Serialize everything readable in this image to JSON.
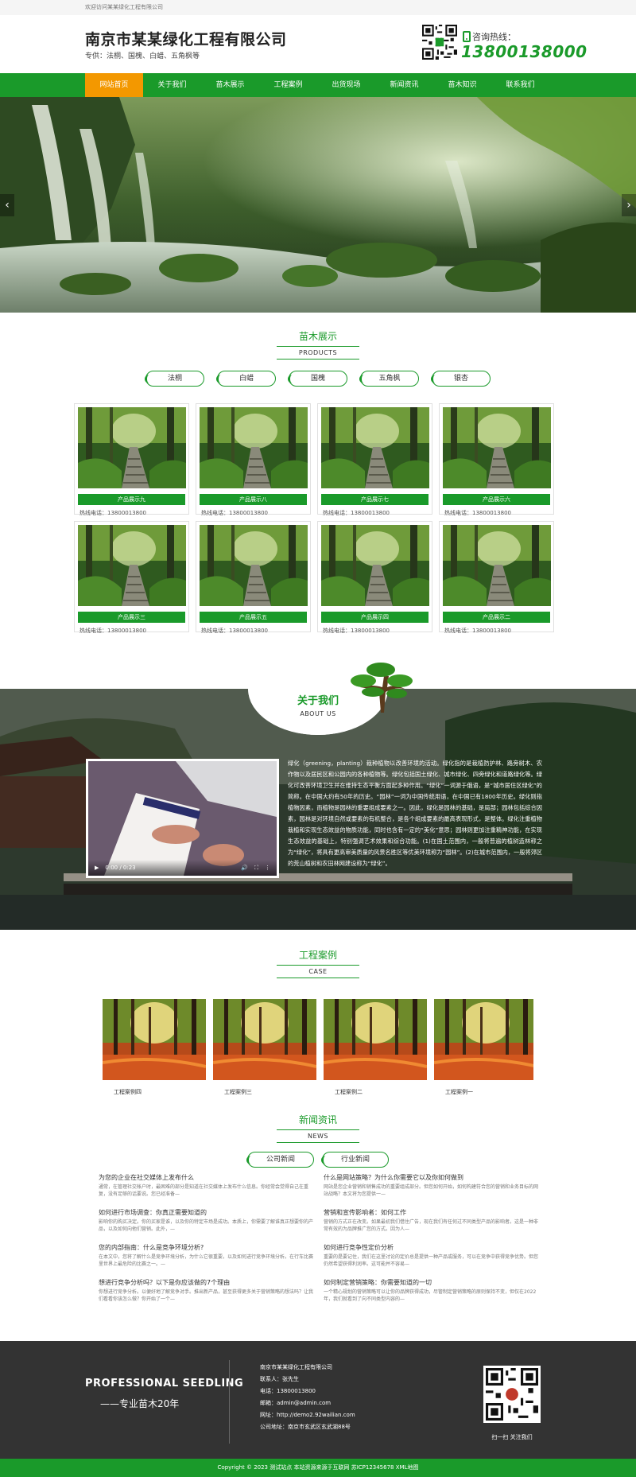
{
  "topbar": {
    "welcome": "欢迎访问某某绿化工程有限公司"
  },
  "header": {
    "company": "南京市某某绿化工程有限公司",
    "slogan": "专供：法桐、国槐、白蜡、五角枫等",
    "hotline_label": "咨询热线：",
    "hotline_number": "13800138000"
  },
  "nav": {
    "items": [
      "网站首页",
      "关于我们",
      "苗木展示",
      "工程案例",
      "出货现场",
      "新闻资讯",
      "苗木知识",
      "联系我们"
    ],
    "active_index": 0
  },
  "banner": {
    "prev_icon": "chevron-left-icon",
    "next_icon": "chevron-right-icon"
  },
  "products": {
    "title_cn": "苗木展示",
    "title_en": "PRODUCTS",
    "tabs": [
      "法桐",
      "白蜡",
      "国槐",
      "五角枫",
      "银杏"
    ],
    "items": [
      {
        "name": "产品展示九",
        "tel": "热线电话：13800013800"
      },
      {
        "name": "产品展示八",
        "tel": "热线电话：13800013800"
      },
      {
        "name": "产品展示七",
        "tel": "热线电话：13800013800"
      },
      {
        "name": "产品展示六",
        "tel": "热线电话：13800013800"
      },
      {
        "name": "产品展示三",
        "tel": "热线电话：13800013800"
      },
      {
        "name": "产品展示五",
        "tel": "热线电话：13800013800"
      },
      {
        "name": "产品展示四",
        "tel": "热线电话：13800013800"
      },
      {
        "name": "产品展示二",
        "tel": "热线电话：13800013800"
      }
    ]
  },
  "about": {
    "title_cn": "关于我们",
    "title_en": "ABOUT US",
    "video_time": "0:00 / 0:23",
    "text": "绿化（greening，planting）栽种植物以改善环境的活动。绿化指的是栽植防护林、路旁树木、农作物以及居民区和公园内的各种植物等。绿化包括国土绿化、城市绿化、四旁绿化和道路绿化等。绿化可改善环境卫生并在维持生态平衡方面起多种作用。“绿化”一词源于俄语，是“城市居住区绿化”的简称。在中国大约有50年的历史。“园林”一词为中国传统用语，在中国已有1800年历史。绿化则指植物因素，而植物是园林的重要组成要素之一。因此，绿化是园林的基础，是局部；园林包括综合因素，园林是对环境自然或要素的有机整合，是各个组成要素的最高表现形式，是整体。绿化注重植物栽植和实现生态效益的物质功能，同时也含有一定的“美化”意思；园林则更加注重精神功能，在实现生态效益的基础上，特别强调艺术效果和综合功能。(1)在国土范围内，一般将普遍的植树造林称之为“绿化”，将具有更高审美质量的风景名胜区等优美环境称为“园林”。(2)在城市范围内，一般将郊区的荒山植树和农田林网建设称为“绿化”。"
  },
  "cases": {
    "title_cn": "工程案例",
    "title_en": "CASE",
    "items": [
      "工程案例四",
      "工程案例三",
      "工程案例二",
      "工程案例一",
      ""
    ]
  },
  "news": {
    "title_cn": "新闻资讯",
    "title_en": "NEWS",
    "tabs": [
      "公司新闻",
      "行业新闻"
    ],
    "left": [
      {
        "title": "为您的企业在社交媒体上发布什么",
        "desc": "通常，在管理社交帐户时，最困难的部分是知道在社交媒体上发布什么信息。你经常会觉得自己在重复，没有足够的话要说。您已经准备—"
      },
      {
        "title": "如何进行市场调查：你真正需要知道的",
        "desc": "影响你的购买决定。你的买家是谁，以及你的特定市场是成功。本质上，你需要了解谁真正想要你的产品，以及如何向他们营销。此外，—"
      },
      {
        "title": "您的内部指南：什么是竞争环境分析?",
        "desc": "在本文中，您将了解什么是竞争环境分析，为什么它很重要，以及如何进行竞争环境分析。在行车比赛里世界上最危险的比赛之一。—"
      },
      {
        "title": "想进行竞争分析吗？以下是你应该做的7个理由",
        "desc": "你想进行竞争分析。以便好地了解竞争对手。推出新产品，甚至获得更多关于营销策略的想法吗？让我们看看你该怎么做？你开始了一个—"
      }
    ],
    "right": [
      {
        "title": "什么是网站策略？为什么你需要它以及你如何做到",
        "desc": "网站是您企业营销和销售成功的重要组成部分。但您如何开始，如何构建符合您的营销和业务目标的网站战略？本文将为您提供一—"
      },
      {
        "title": "营销和宣传影响者：如何工作",
        "desc": "营销的方式正在改变。如果最初我们借住广告，现在我们有任何过不同类型产品的影响者。这是一种非常有效的为品牌推广您的方式。因为人—"
      },
      {
        "title": "如何进行竞争性定价分析",
        "desc": "重要的是要记住，我们在这里讨论的定价总是提供一种产品或服务，可以在竞争中获得竞争优势。但您仍然希望获得利润率。这可能并不容易—"
      },
      {
        "title": "如何制定营销策略：你需要知道的一切",
        "desc": "一个精心规划的营销策略可以让你的品牌获得成功，尽管制定营销策略的原则保持不变，但仅在2022年，我们就看到了向不同类型内容的—"
      }
    ]
  },
  "footer": {
    "slogan_en": "PROFESSIONAL SEEDLING",
    "slogan_cn": "——专业苗木20年",
    "company": "南京市某某绿化工程有限公司",
    "contact": "联系人：张先生",
    "phone": "电话：13800013800",
    "email": "邮箱：admin@admin.com",
    "site": "网址：http://demo2.92wailian.com",
    "address": "公司地址：南京市玄武区玄武湖88号",
    "qr_label": "扫一扫 关注我们",
    "copyright": "Copyright © 2023 测试站点  本站资源来源于互联网  苏ICP12345678   XML地图"
  },
  "colors": {
    "brand": "#1a9a2a",
    "accent": "#f39800",
    "footer": "#333333"
  }
}
